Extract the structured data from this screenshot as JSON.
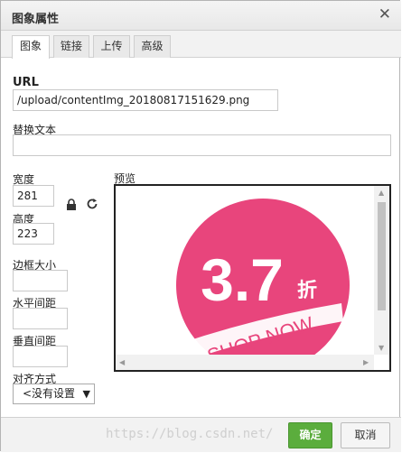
{
  "dialog": {
    "title": "图象属性",
    "close_glyph": "✕"
  },
  "tabs": [
    {
      "label": "图象",
      "active": true
    },
    {
      "label": "链接",
      "active": false
    },
    {
      "label": "上传",
      "active": false
    },
    {
      "label": "高级",
      "active": false
    }
  ],
  "form": {
    "url_label": "URL",
    "url_value": "/upload/contentImg_20180817151629.png",
    "alt_label": "替换文本",
    "alt_value": "",
    "width_label": "宽度",
    "width_value": "281",
    "height_label": "高度",
    "height_value": "223",
    "border_label": "边框大小",
    "border_value": "",
    "hspace_label": "水平间距",
    "hspace_value": "",
    "vspace_label": "垂直间距",
    "vspace_value": "",
    "align_label": "对齐方式",
    "align_value": "<没有设置",
    "lock_icon": "lock-icon",
    "reset_icon": "reset-size-icon"
  },
  "preview": {
    "label": "预览",
    "badge_main": "3.7",
    "badge_suffix": "折",
    "badge_sub": "SHOP NOW",
    "badge_color": "#e8457c"
  },
  "footer": {
    "ok_label": "确定",
    "cancel_label": "取消"
  },
  "watermark": "https://blog.csdn.net/"
}
